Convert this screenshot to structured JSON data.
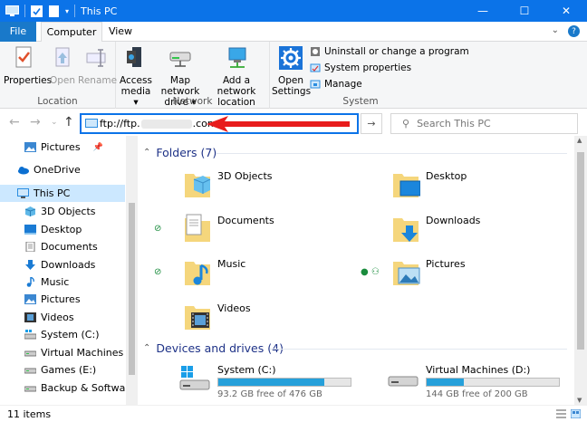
{
  "window": {
    "title": "This PC",
    "minimize": "—",
    "maximize": "☐",
    "close": "✕"
  },
  "tabs": {
    "file": "File",
    "computer": "Computer",
    "view": "View"
  },
  "ribbon": {
    "location": {
      "label": "Location",
      "properties": "Properties",
      "open": "Open",
      "rename": "Rename"
    },
    "network": {
      "label": "Network",
      "access_media_1": "Access",
      "access_media_2": "media ▾",
      "map_drive_1": "Map network",
      "map_drive_2": "drive ▾",
      "add_location_1": "Add a network",
      "add_location_2": "location"
    },
    "system": {
      "label": "System",
      "open_settings_1": "Open",
      "open_settings_2": "Settings",
      "uninstall": "Uninstall or change a program",
      "system_properties": "System properties",
      "manage": "Manage"
    }
  },
  "address": {
    "prefix": "ftp://ftp.",
    "suffix": ".com"
  },
  "search": {
    "placeholder": "Search This PC"
  },
  "sidebar": {
    "items": [
      {
        "label": "Pictures"
      },
      {
        "label": "OneDrive"
      },
      {
        "label": "This PC"
      },
      {
        "label": "3D Objects"
      },
      {
        "label": "Desktop"
      },
      {
        "label": "Documents"
      },
      {
        "label": "Downloads"
      },
      {
        "label": "Music"
      },
      {
        "label": "Pictures"
      },
      {
        "label": "Videos"
      },
      {
        "label": "System (C:)"
      },
      {
        "label": "Virtual Machines (D:)"
      },
      {
        "label": "Games (E:)"
      },
      {
        "label": "Backup & Software (F:"
      }
    ]
  },
  "folders": {
    "header": "Folders (7)",
    "items": [
      {
        "name": "3D Objects"
      },
      {
        "name": "Desktop"
      },
      {
        "name": "Documents"
      },
      {
        "name": "Downloads"
      },
      {
        "name": "Music"
      },
      {
        "name": "Pictures"
      },
      {
        "name": "Videos"
      }
    ]
  },
  "drives": {
    "header": "Devices and drives (4)",
    "items": [
      {
        "name": "System (C:)",
        "free": "93.2 GB free of 476 GB",
        "used_fraction": 0.8
      },
      {
        "name": "Virtual Machines (D:)",
        "free": "144 GB free of 200 GB",
        "used_fraction": 0.28
      }
    ]
  },
  "status": {
    "count": "11 items"
  },
  "colors": {
    "accent": "#0b73e8",
    "drive_bar": "#26a0da",
    "annotation_arrow": "#e81c1c",
    "section_header": "#1e3287"
  }
}
